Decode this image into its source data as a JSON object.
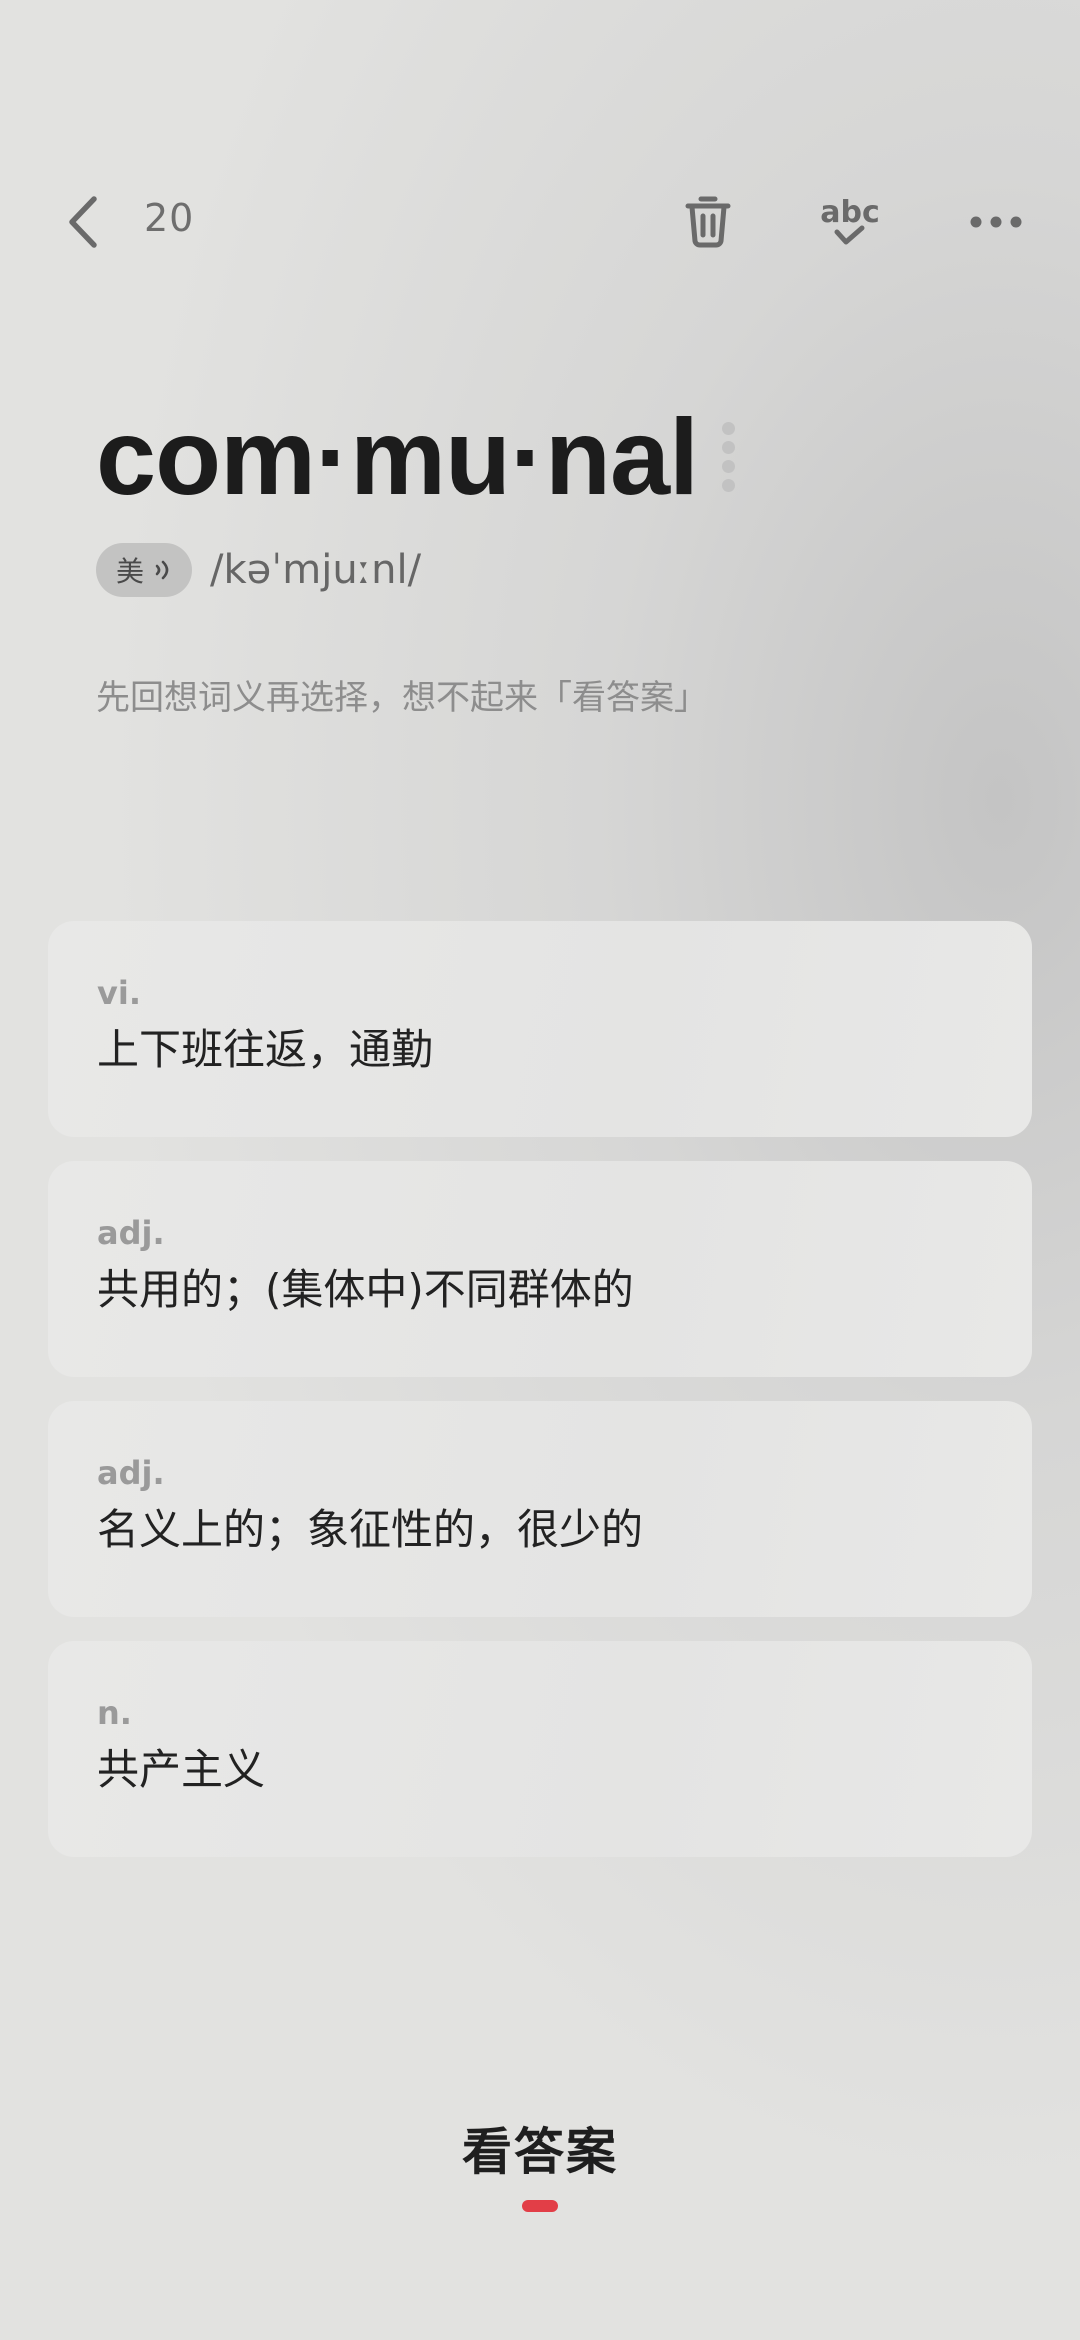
{
  "header": {
    "count": "20",
    "back_icon": "chevron-left-icon",
    "trash_icon": "trash-icon",
    "spell_icon": "abc-check-icon",
    "more_icon": "more-horizontal-icon"
  },
  "word": {
    "text": "com·mu·nal",
    "accent": "美",
    "phonetic": "/kəˈmjuːnl/"
  },
  "hint": "先回想词义再选择，想不起来「看答案」",
  "options": [
    {
      "pos": "vi.",
      "definition": "上下班往返，通勤"
    },
    {
      "pos": "adj.",
      "definition": "共用的；(集体中)不同群体的"
    },
    {
      "pos": "adj.",
      "definition": "名义上的；象征性的，很少的"
    },
    {
      "pos": "n.",
      "definition": "共产主义"
    }
  ],
  "footer": {
    "show_answer_label": "看答案",
    "accent_color": "#e23e47"
  }
}
